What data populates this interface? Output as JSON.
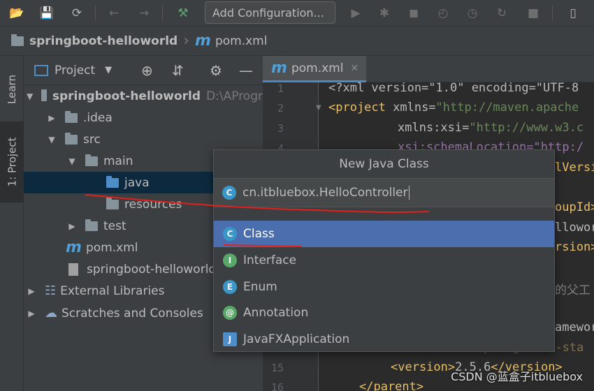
{
  "toolbar": {
    "add_configuration": "Add Configuration..."
  },
  "breadcrumb": {
    "project": "springboot-helloworld",
    "file": "pom.xml"
  },
  "side_tabs": {
    "learn": "Learn",
    "project": "1: Project"
  },
  "project_panel": {
    "title": "Project",
    "tree": [
      {
        "label": "springboot-helloworld",
        "suffix": "D:\\AProgr"
      },
      {
        "label": ".idea"
      },
      {
        "label": "src"
      },
      {
        "label": "main"
      },
      {
        "label": "java"
      },
      {
        "label": "resources"
      },
      {
        "label": "test"
      },
      {
        "label": "pom.xml"
      },
      {
        "label": "springboot-helloworld"
      },
      {
        "label": "External Libraries"
      },
      {
        "label": "Scratches and Consoles"
      }
    ]
  },
  "editor": {
    "tab_label": "pom.xml",
    "line_numbers": [
      "1",
      "2",
      "3",
      "4",
      "15",
      "16"
    ],
    "lines": {
      "l1": "<?xml version=\"1.0\" encoding=\"UTF-8",
      "l2_tag": "<project",
      "l2_attr": " xmlns=",
      "l2_val": "\"http://maven.apache",
      "l3_attr": "xmlns:xsi=",
      "l3_val": "\"http://www.w3.c",
      "l4": "xsi:schemaLocation=\"http:/",
      "r5": "lVersi",
      "r7": "oupId>",
      "r8": "llowor",
      "r9": "rsion>",
      "r11": "的父工",
      "r13": "amewor",
      "l14": "<artifactId>spring-boot-sta",
      "l15_open": "<version>",
      "l15_val": "2.5.6",
      "l15_close": "</version>",
      "l16": "</parent>"
    }
  },
  "popup": {
    "title": "New Java Class",
    "input_value": "cn.itbluebox.HelloController",
    "kinds": [
      {
        "label": "Class",
        "icon": "C"
      },
      {
        "label": "Interface",
        "icon": "I"
      },
      {
        "label": "Enum",
        "icon": "E"
      },
      {
        "label": "Annotation",
        "icon": "@"
      },
      {
        "label": "JavaFXApplication",
        "icon": "J"
      }
    ]
  },
  "watermark": "CSDN @蓝盒子itbluebox"
}
